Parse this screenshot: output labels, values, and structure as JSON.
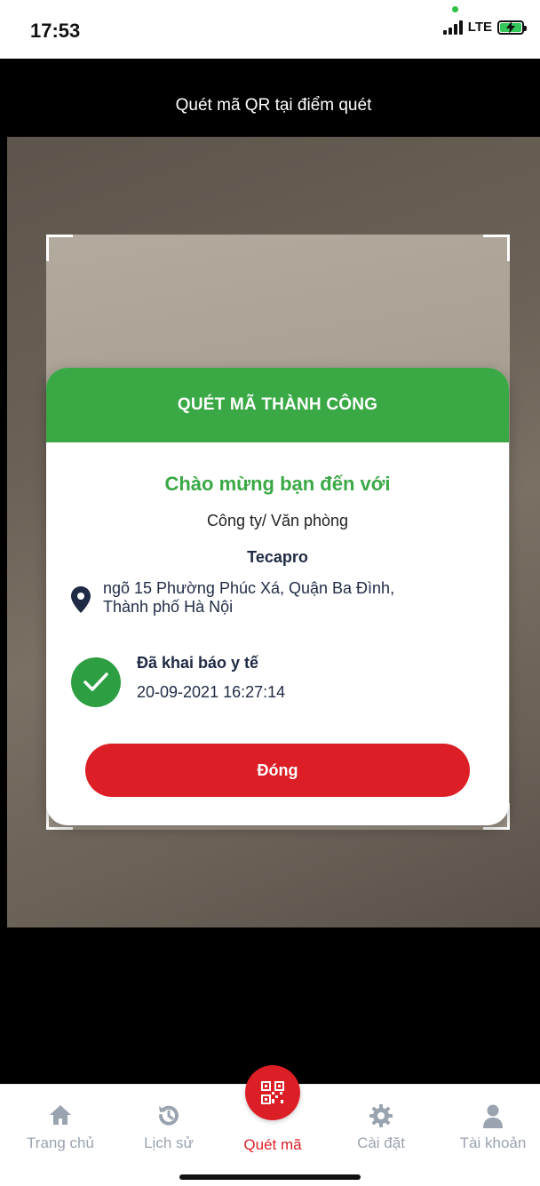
{
  "status_bar": {
    "time": "17:53",
    "network": "LTE"
  },
  "header": {
    "title": "Quét mã QR tại điểm quét"
  },
  "modal": {
    "title": "QUÉT MÃ THÀNH CÔNG",
    "welcome": "Chào mừng bạn đến với",
    "organization_type": "Công ty/ Văn phòng",
    "organization_name": "Tecapro",
    "address_line1": "ngõ 15 Phường Phúc Xá, Quận Ba Đình,",
    "address_line2": "Thành phố Hà Nội",
    "declared_label": "Đã khai báo y tế",
    "declared_time": "20-09-2021 16:27:14",
    "close_label": "Đóng"
  },
  "bottom_nav": {
    "items": [
      {
        "label": "Trang chủ",
        "icon": "home-icon"
      },
      {
        "label": "Lịch sử",
        "icon": "history-icon"
      },
      {
        "label": "Quét mã",
        "icon": "qr-code-icon",
        "active": true
      },
      {
        "label": "Cài đặt",
        "icon": "gear-icon"
      },
      {
        "label": "Tài khoản",
        "icon": "user-icon"
      }
    ]
  },
  "colors": {
    "success_green": "#3aa845",
    "danger_red": "#dc1f26",
    "text_dark": "#1f2a44",
    "nav_inactive": "#9aa3b0"
  }
}
